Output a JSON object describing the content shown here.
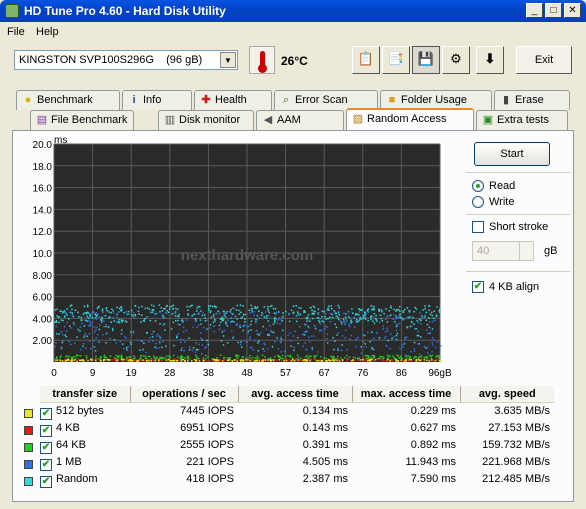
{
  "window": {
    "title": "HD Tune Pro 4.60 - Hard Disk Utility",
    "min": "_",
    "max": "□",
    "close": "✕"
  },
  "menu": {
    "file": "File",
    "help": "Help"
  },
  "toolbar": {
    "device": "KINGSTON SVP100S296G    (96 gB)",
    "temperature": "26°C",
    "exit": "Exit",
    "icons": [
      "copy-info-icon",
      "copy-screenshot-icon",
      "save-icon",
      "options-icon",
      "download-icon"
    ]
  },
  "tabs_row1": [
    {
      "label": "Benchmark",
      "icon": "bulb-icon"
    },
    {
      "label": "Info",
      "icon": "info-icon"
    },
    {
      "label": "Health",
      "icon": "health-cross-icon"
    },
    {
      "label": "Error Scan",
      "icon": "magnifier-icon"
    },
    {
      "label": "Folder Usage",
      "icon": "folder-icon"
    },
    {
      "label": "Erase",
      "icon": "trash-icon"
    }
  ],
  "tabs_row2": [
    {
      "label": "File Benchmark",
      "icon": "file-benchmark-icon"
    },
    {
      "label": "Disk monitor",
      "icon": "disk-monitor-icon"
    },
    {
      "label": "AAM",
      "icon": "speaker-icon"
    },
    {
      "label": "Random Access",
      "icon": "random-access-icon",
      "active": true
    },
    {
      "label": "Extra tests",
      "icon": "extra-tests-icon"
    }
  ],
  "controls": {
    "start": "Start",
    "read": "Read",
    "write": "Write",
    "mode": "read",
    "short_stroke": "Short stroke",
    "short_stroke_checked": false,
    "stroke_value": "40",
    "stroke_unit": "gB",
    "align": "4 KB align",
    "align_checked": true
  },
  "chart_data": {
    "type": "scatter",
    "ylabel": "ms",
    "xunit": "gB",
    "xlim": [
      0,
      96
    ],
    "ylim": [
      0,
      20
    ],
    "x_ticks": [
      "0",
      "9",
      "19",
      "28",
      "38",
      "48",
      "57",
      "67",
      "76",
      "86",
      "96gB"
    ],
    "y_ticks": [
      "2.00",
      "4.00",
      "6.00",
      "8.00",
      "10.0",
      "12.0",
      "14.0",
      "16.0",
      "18.0",
      "20.0"
    ],
    "watermark": "nexthardware.com",
    "series": [
      {
        "name": "512 bytes",
        "color": "#e8e820",
        "approx_ms": 0.13
      },
      {
        "name": "4 KB",
        "color": "#e81818",
        "approx_ms": 0.14
      },
      {
        "name": "64 KB",
        "color": "#20d020",
        "approx_ms": 0.39
      },
      {
        "name": "1 MB",
        "color": "#3070e8",
        "approx_ms": 4.5
      },
      {
        "name": "Random",
        "color": "#30d8d8",
        "approx_ms": 2.4
      }
    ]
  },
  "results": {
    "headers": [
      "transfer size",
      "operations / sec",
      "avg. access time",
      "max. access time",
      "avg. speed"
    ],
    "rows": [
      {
        "size": "512 bytes",
        "color": "#e8e820",
        "ops": "7445 IOPS",
        "avg": "0.134 ms",
        "max": "0.229 ms",
        "speed": "3.635 MB/s"
      },
      {
        "size": "4 KB",
        "color": "#e81818",
        "ops": "6951 IOPS",
        "avg": "0.143 ms",
        "max": "0.627 ms",
        "speed": "27.153 MB/s"
      },
      {
        "size": "64 KB",
        "color": "#20d020",
        "ops": "2555 IOPS",
        "avg": "0.391 ms",
        "max": "0.892 ms",
        "speed": "159.732 MB/s"
      },
      {
        "size": "1 MB",
        "color": "#3070e8",
        "ops": "221 IOPS",
        "avg": "4.505 ms",
        "max": "11.943 ms",
        "speed": "221.968 MB/s"
      },
      {
        "size": "Random",
        "color": "#30d8d8",
        "ops": "418 IOPS",
        "avg": "2.387 ms",
        "max": "7.590 ms",
        "speed": "212.485 MB/s"
      }
    ]
  }
}
